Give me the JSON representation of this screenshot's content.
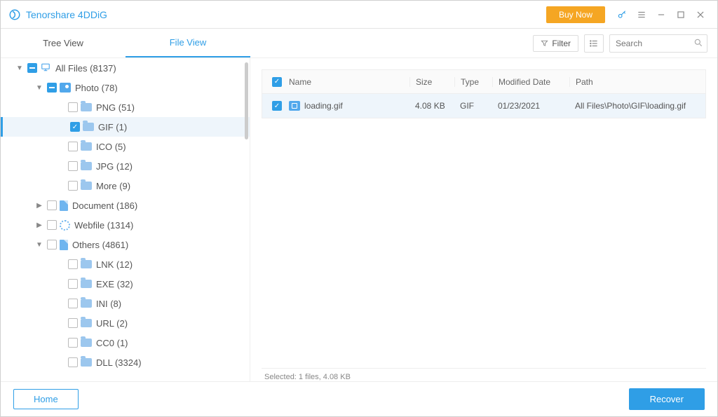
{
  "app": {
    "title": "Tenorshare 4DDiG",
    "buy_label": "Buy Now"
  },
  "tabs": {
    "tree": "Tree View",
    "file": "File View"
  },
  "toolbar": {
    "filter": "Filter",
    "search_placeholder": "Search"
  },
  "tree": {
    "all_files": "All Files (8137)",
    "photo": "Photo (78)",
    "png": "PNG (51)",
    "gif": "GIF (1)",
    "ico": "ICO (5)",
    "jpg": "JPG (12)",
    "more": "More (9)",
    "document": "Document (186)",
    "webfile": "Webfile (1314)",
    "others": "Others (4861)",
    "lnk": "LNK (12)",
    "exe": "EXE (32)",
    "ini": "INI (8)",
    "url": "URL (2)",
    "cc0": "CC0 (1)",
    "dll": "DLL (3324)"
  },
  "table": {
    "headers": {
      "name": "Name",
      "size": "Size",
      "type": "Type",
      "date": "Modified Date",
      "path": "Path"
    },
    "rows": [
      {
        "name": "loading.gif",
        "size": "4.08 KB",
        "type": "GIF",
        "date": "01/23/2021",
        "path": "All Files\\Photo\\GIF\\loading.gif"
      }
    ]
  },
  "status": "Selected: 1 files, 4.08 KB",
  "footer": {
    "home": "Home",
    "recover": "Recover"
  }
}
